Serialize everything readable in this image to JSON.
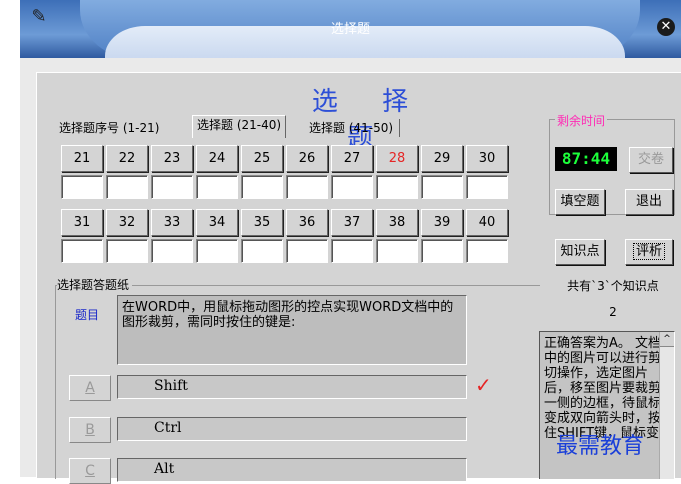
{
  "window": {
    "title": "选择题"
  },
  "heading": "选 择 题",
  "tabs": [
    {
      "label": "选择题序号 (1-21)"
    },
    {
      "label": "选择题 (21-40)"
    },
    {
      "label": "选择题 (41-50)"
    }
  ],
  "questions_row1": [
    "21",
    "22",
    "23",
    "24",
    "25",
    "26",
    "27",
    "28",
    "29",
    "30"
  ],
  "questions_row2": [
    "31",
    "32",
    "33",
    "34",
    "35",
    "36",
    "37",
    "38",
    "39",
    "40"
  ],
  "current_question": "28",
  "timer": {
    "label": "剩余时间",
    "value": "87:44"
  },
  "buttons": {
    "submit": "交卷",
    "fill_blank": "填空题",
    "exit": "退出",
    "knowledge": "知识点",
    "analysis": "评析"
  },
  "knowledge_count_text": "共有`3`个知识点",
  "knowledge_index": "2",
  "explanation": "正确答案为A。 文档中的图片可以进行剪切操作，选定图片后，移至图片要裁剪一侧的边框，待鼠标变成双向箭头时，按住SHIFT键，鼠标变",
  "answer_sheet": {
    "label": "选择题答题纸",
    "question_label": "题目",
    "question_text": "在WORD中，用鼠标拖动图形的控点实现WORD文档中的图形裁剪，需同时按住的键是:",
    "options": [
      {
        "key": "A",
        "text": "Shift"
      },
      {
        "key": "B",
        "text": "Ctrl"
      },
      {
        "key": "C",
        "text": "Alt"
      }
    ],
    "correct_mark": "✓"
  },
  "watermark": "最需教育",
  "colors": {
    "accent_blue": "#2d4fd7",
    "timer_green": "#1cff3a",
    "timer_label_pink": "#ff2bb5",
    "current_red": "#e52525"
  }
}
